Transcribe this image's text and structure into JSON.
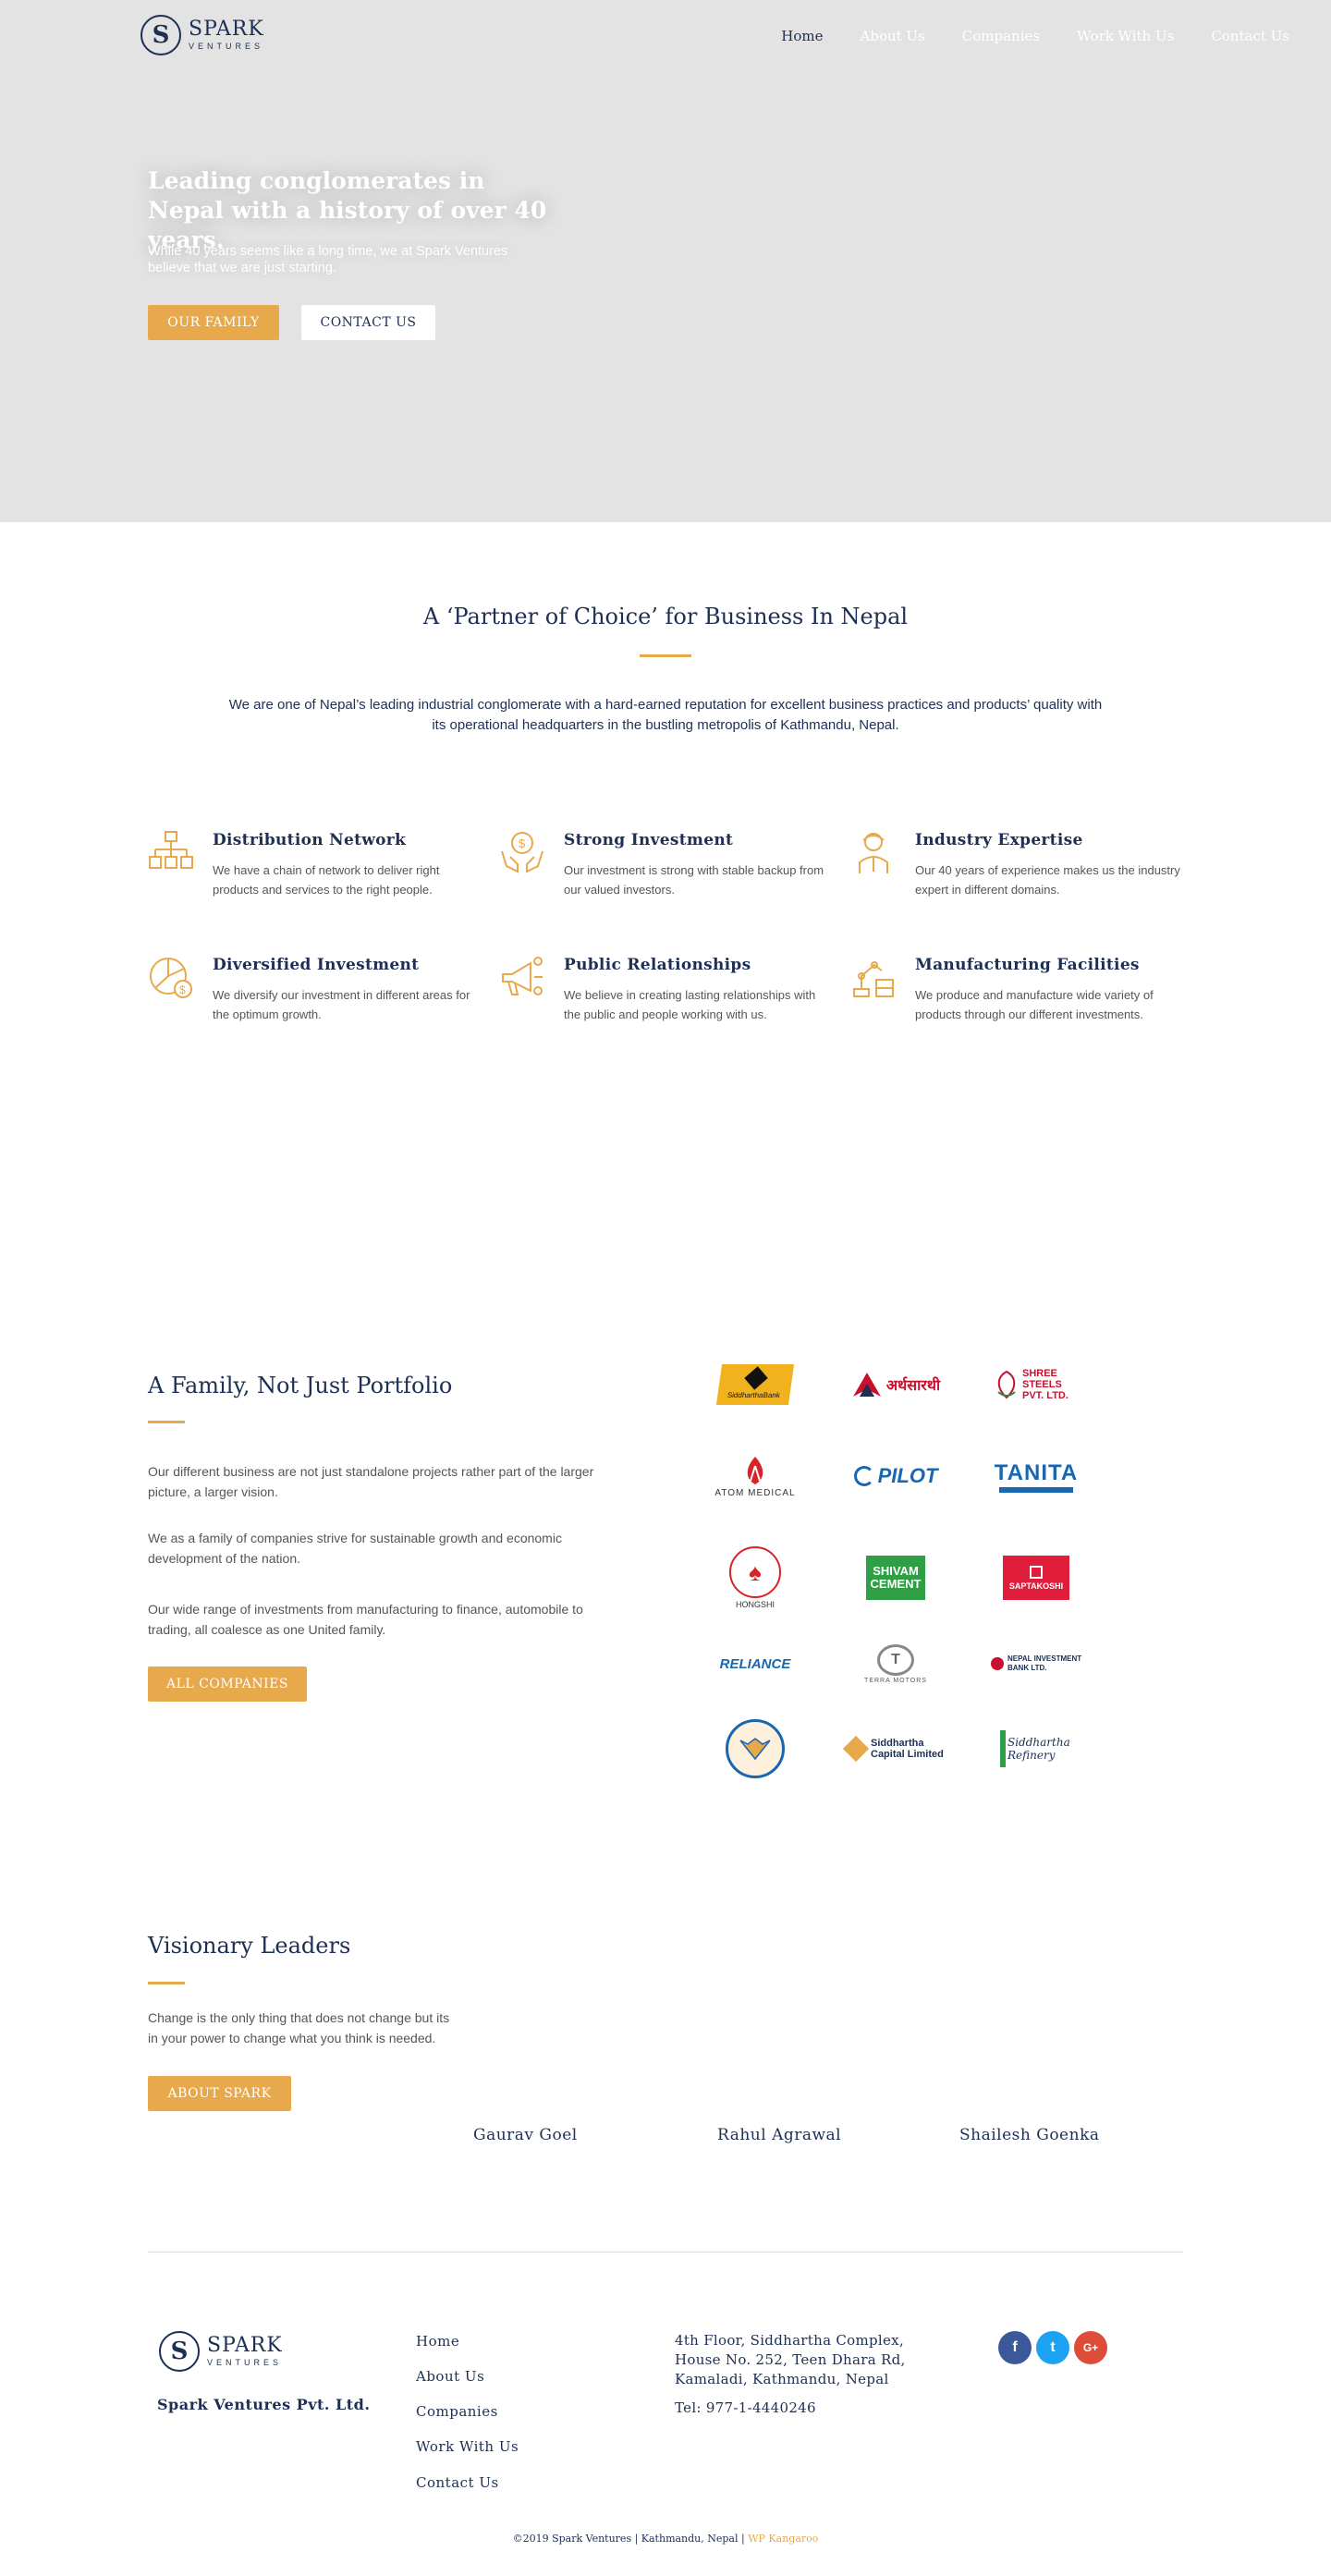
{
  "header": {
    "logo": {
      "mark": "S",
      "name": "SPARK",
      "tagline": "VENTURES"
    },
    "nav": [
      "Home",
      "About Us",
      "Companies",
      "Work With Us",
      "Contact Us"
    ]
  },
  "hero": {
    "title": "Leading conglomerates in Nepal with a history of over 40 years.",
    "subtitle": "While 40 years seems like a long time, we at Spark Ventures believe that we are just starting.",
    "primary_button": "OUR FAMILY",
    "secondary_button": "CONTACT US"
  },
  "partner": {
    "title": "A ‘Partner of Choice’ for Business In Nepal",
    "text": "We are one of Nepal’s leading industrial conglomerate with a hard-earned reputation for excellent business practices and products’ quality with its operational headquarters in the bustling metropolis of Kathmandu, Nepal.",
    "features": [
      {
        "icon": "distribution-network-icon",
        "title": "Distribution Network",
        "text": "We have a chain of network to deliver right products and services to the right people."
      },
      {
        "icon": "investment-hands-icon",
        "title": "Strong Investment",
        "text": "Our investment is strong with stable backup from our valued investors."
      },
      {
        "icon": "expert-person-icon",
        "title": "Industry Expertise",
        "text": "Our 40 years of experience makes us the industry expert in different domains."
      },
      {
        "icon": "diversified-chart-icon",
        "title": "Diversified Investment",
        "text": "We diversify our investment in different areas for the optimum growth."
      },
      {
        "icon": "megaphone-icon",
        "title": "Public Relationships",
        "text": "We believe in creating lasting relationships with the public and people working with us."
      },
      {
        "icon": "factory-robot-icon",
        "title": "Manufacturing Facilities",
        "text": "We produce and manufacture wide variety of products through our different investments."
      }
    ]
  },
  "family": {
    "title": "A Family, Not Just Portfolio",
    "paragraphs": [
      "Our different business are not just standalone projects rather part of the larger picture, a larger vision.",
      "We as a family of companies strive for sustainable growth and economic development of the nation.",
      "Our wide range of investments from manufacturing to finance, automobile to trading, all coalesce as one United family."
    ],
    "button": "ALL COMPANIES",
    "logos": [
      {
        "name": "siddhartha-bank-logo",
        "label": "SiddharthaBank"
      },
      {
        "name": "arthasarathi-logo",
        "label": "अर्थसारथी"
      },
      {
        "name": "shree-steels-logo",
        "label": "SHREE STEELS PVT. LTD."
      },
      {
        "name": "atom-medical-logo",
        "label": "ATOM MEDICAL"
      },
      {
        "name": "pilot-logo",
        "label": "PILOT"
      },
      {
        "name": "tanita-logo",
        "label": "TANITA"
      },
      {
        "name": "hongshi-cement-logo",
        "label": "HONGSHI"
      },
      {
        "name": "shivam-cement-logo",
        "label": "SHIVAM CEMENT"
      },
      {
        "name": "saptakoshi-cement-logo",
        "label": "SAPTAKOSHI"
      },
      {
        "name": "reliance-logo",
        "label": "RELIANCE"
      },
      {
        "name": "terra-motors-logo",
        "label": "TERRA MOTORS"
      },
      {
        "name": "nepal-investment-bank-logo",
        "label": "NEPAL INVESTMENT BANK LTD."
      },
      {
        "name": "siddhartha-cement-logo",
        "label": ""
      },
      {
        "name": "siddhartha-capital-logo",
        "label": "Siddhartha Capital Limited"
      },
      {
        "name": "siddhartha-refinery-logo",
        "label": "Siddhartha Refinery"
      }
    ]
  },
  "leaders": {
    "title": "Visionary Leaders",
    "text": "Change is the only thing that does not change but its in your power to change what you think is needed.",
    "button": "ABOUT SPARK",
    "people": [
      "Gaurav Goel",
      "Rahul Agrawal",
      "Shailesh Goenka"
    ]
  },
  "footer": {
    "company": "Spark Ventures Pvt. Ltd.",
    "links": [
      "Home",
      "About Us",
      "Companies",
      "Work With Us",
      "Contact Us"
    ],
    "address": [
      "4th Floor, Siddhartha Complex,",
      "House No. 252, Teen Dhara Rd,",
      "Kamaladi, Kathmandu, Nepal"
    ],
    "phone": "Tel: 977-1-4440246",
    "social": [
      {
        "name": "facebook-icon",
        "glyph": "f",
        "color": "#3b5998"
      },
      {
        "name": "twitter-icon",
        "glyph": "t",
        "color": "#1da1f2"
      },
      {
        "name": "google-plus-icon",
        "glyph": "G+",
        "color": "#dd4b39"
      }
    ],
    "copyright": "©2019 Spark Ventures | Kathmandu, Nepal |",
    "credit": "WP Kangaroo"
  },
  "colors": {
    "accent": "#e8a84c",
    "navy": "#1d2f54",
    "hero_bg": "#e3e3e3"
  }
}
